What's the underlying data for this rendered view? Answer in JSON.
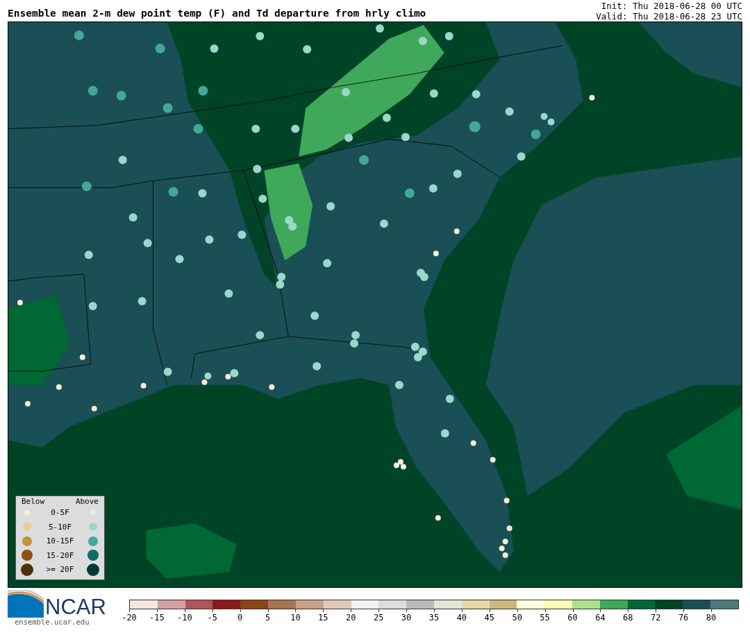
{
  "header": {
    "title": "Ensemble mean 2-m dew point temp (F) and Td departure from hrly climo",
    "init": "Init: Thu 2018-06-28 00 UTC",
    "valid": "Valid: Thu 2018-06-28 23 UTC"
  },
  "legend": {
    "below_heading": "Below",
    "above_heading": "Above",
    "rows": [
      {
        "label": "0-5F",
        "below": {
          "color": "#f5edd6"
        },
        "above": {
          "color": "#d8f0ec"
        }
      },
      {
        "label": "5-10F",
        "below": {
          "color": "#e6d08c"
        },
        "above": {
          "color": "#9ad8cc"
        }
      },
      {
        "label": "10-15F",
        "below": {
          "color": "#c8903c"
        },
        "above": {
          "color": "#44a898"
        }
      },
      {
        "label": "15-20F",
        "below": {
          "color": "#8b5010"
        },
        "above": {
          "color": "#0a6e66"
        }
      },
      {
        "label": ">= 20F",
        "below": {
          "color": "#50300a"
        },
        "above": {
          "color": "#003c30"
        }
      }
    ]
  },
  "logo": {
    "wordmark": "NCAR",
    "url": "ensemble.ucar.edu"
  },
  "colorbar": {
    "segments": [
      {
        "tick": "-20",
        "color": "#f5e6e6"
      },
      {
        "tick": "-15",
        "color": "#d4a0a4"
      },
      {
        "tick": "-10",
        "color": "#b05456"
      },
      {
        "tick": "-5",
        "color": "#8b1a1e"
      },
      {
        "tick": "0",
        "color": "#8b4513"
      },
      {
        "tick": "5",
        "color": "#a87452"
      },
      {
        "tick": "10",
        "color": "#c8a088"
      },
      {
        "tick": "15",
        "color": "#e0c8b8"
      },
      {
        "tick": "20",
        "color": "#f2f2f2"
      },
      {
        "tick": "25",
        "color": "#dcdcdc"
      },
      {
        "tick": "30",
        "color": "#bababa"
      },
      {
        "tick": "35",
        "color": "#e2e4d6"
      },
      {
        "tick": "40",
        "color": "#e8d8a8"
      },
      {
        "tick": "45",
        "color": "#cdb87a"
      },
      {
        "tick": "50",
        "color": "#fffee0"
      },
      {
        "tick": "55",
        "color": "#f8ffb0"
      },
      {
        "tick": "60",
        "color": "#ade08c"
      },
      {
        "tick": "64",
        "color": "#40a85a"
      },
      {
        "tick": "68",
        "color": "#006834"
      },
      {
        "tick": "72",
        "color": "#004428"
      },
      {
        "tick": "76",
        "color": "#1a4f55"
      },
      {
        "tick": "80",
        "color": "#4e7a7c"
      }
    ]
  }
}
